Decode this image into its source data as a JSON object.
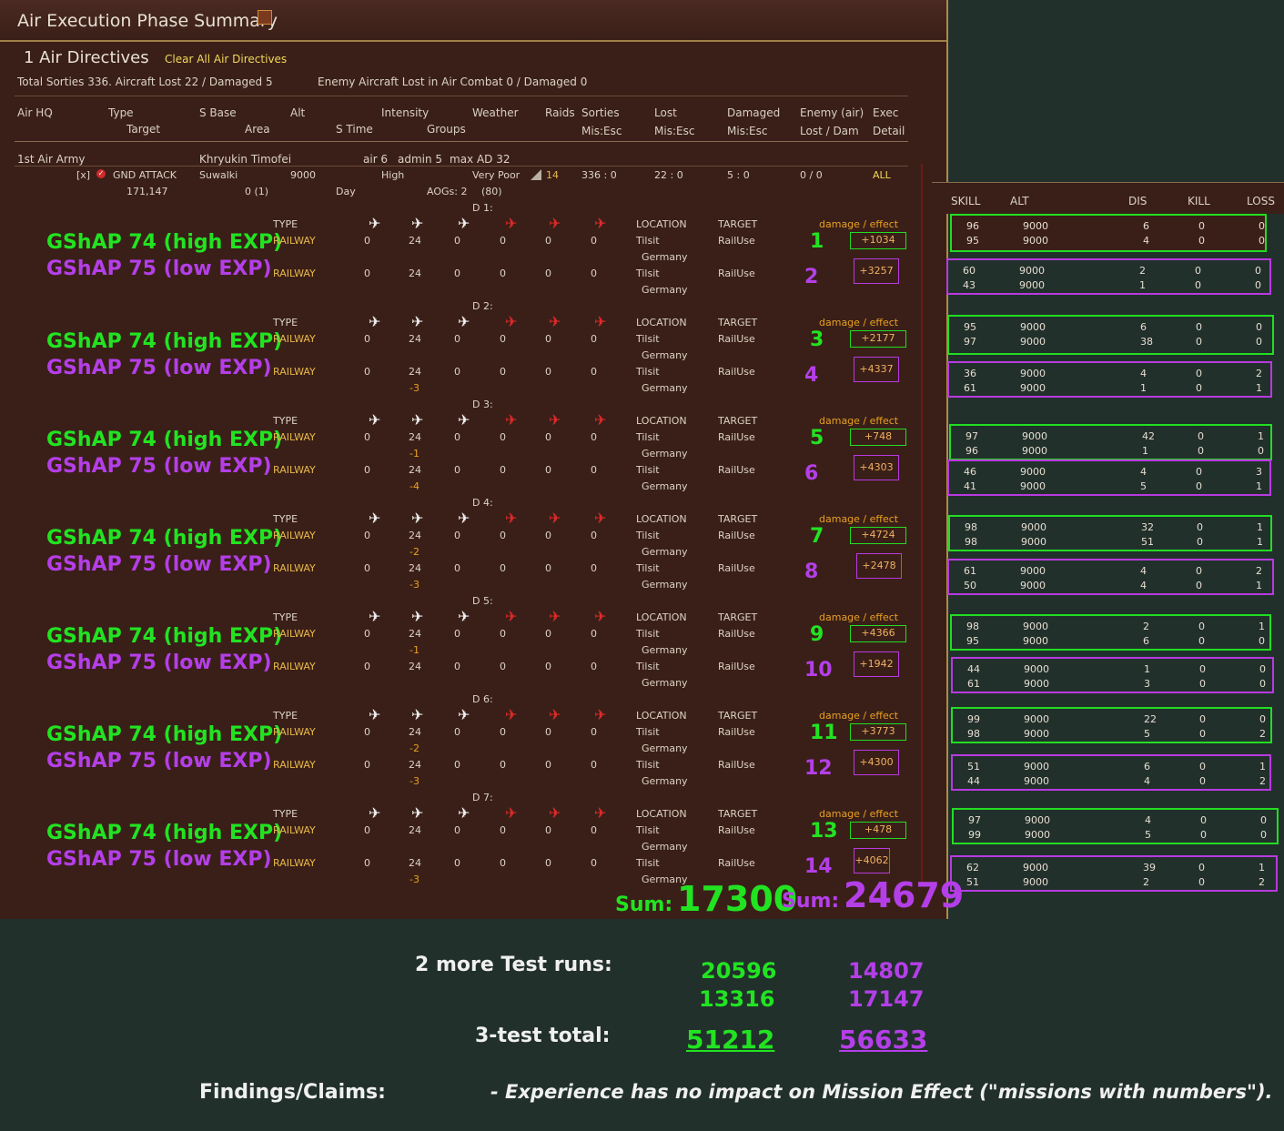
{
  "window": {
    "title": "Air Execution Phase Summary",
    "icon": "notes-icon"
  },
  "directives": {
    "title": "1 Air Directives",
    "clear_link": "Clear All Air Directives"
  },
  "summary": {
    "sorties": "Total Sorties 336. Aircraft Lost 22 / Damaged 5",
    "enemy": "Enemy Aircraft Lost in Air Combat 0 / Damaged 0"
  },
  "columns": {
    "air_hq": "Air HQ",
    "type": "Type",
    "target": "Target",
    "s_base": "S Base",
    "area": "Area",
    "alt": "Alt",
    "s_time": "S Time",
    "intensity": "Intensity",
    "groups": "Groups",
    "weather": "Weather",
    "raids": "Raids",
    "sorties": "Sorties",
    "mis_esc1": "Mis:Esc",
    "lost": "Lost",
    "mis_esc2": "Mis:Esc",
    "damaged": "Damaged",
    "mis_esc3": "Mis:Esc",
    "enemy_air": "Enemy (air)",
    "lost_dam": "Lost / Dam",
    "exec": "Exec",
    "detail": "Detail"
  },
  "hq": {
    "name": "1st Air Army",
    "commander": "Khryukin Timofei",
    "air": "air 6",
    "admin": "admin 5",
    "max_ad": "max AD 32"
  },
  "mission": {
    "checkbox": "[x]",
    "type": "GND ATTACK",
    "target": "Suwalki",
    "alt": "9000",
    "intensity": "High",
    "weather": "Very Poor",
    "raids": "14",
    "sorties": "336 : 0",
    "lost": "22 : 0",
    "damaged": "5 : 0",
    "enemy": "0 / 0",
    "exec": "ALL",
    "coords": "171,147",
    "area": "0 (1)",
    "s_time": "Day",
    "groups": "AOGs: 2",
    "groups_n": "(80)"
  },
  "labels": {
    "type": "TYPE",
    "location": "LOCATION",
    "target": "TARGET",
    "damage_effect": "damage / effect",
    "country": "Germany",
    "sum": "Sum:"
  },
  "days": [
    {
      "label": "D 1:",
      "a": {
        "name": "GShAP 74 (high EXP)",
        "type": "RAILWAY",
        "v1": "0",
        "v2": "24",
        "v3": "0",
        "v4": "0",
        "v5": "0",
        "v6": "0",
        "loss": "",
        "loc": "Tilsit",
        "target": "RailUse",
        "num": "1",
        "eff": "+1034"
      },
      "b": {
        "name": "GShAP 75 (low EXP)",
        "type": "RAILWAY",
        "v1": "0",
        "v2": "24",
        "v3": "0",
        "v4": "0",
        "v5": "0",
        "v6": "0",
        "loss": "",
        "loc": "Tilsit",
        "target": "RailUse",
        "num": "2",
        "eff": "+3257"
      }
    },
    {
      "label": "D 2:",
      "a": {
        "name": "GShAP 74 (high EXP)",
        "type": "RAILWAY",
        "v1": "0",
        "v2": "24",
        "v3": "0",
        "v4": "0",
        "v5": "0",
        "v6": "0",
        "loss": "",
        "loc": "Tilsit",
        "target": "RailUse",
        "num": "3",
        "eff": "+2177"
      },
      "b": {
        "name": "GShAP 75 (low EXP)",
        "type": "RAILWAY",
        "v1": "0",
        "v2": "24",
        "v3": "0",
        "v4": "0",
        "v5": "0",
        "v6": "0",
        "loss": "-3",
        "loc": "Tilsit",
        "target": "RailUse",
        "num": "4",
        "eff": "+4337"
      }
    },
    {
      "label": "D 3:",
      "a": {
        "name": "GShAP 74 (high EXP)",
        "type": "RAILWAY",
        "v1": "0",
        "v2": "24",
        "v3": "0",
        "v4": "0",
        "v5": "0",
        "v6": "0",
        "loss": "-1",
        "loc": "Tilsit",
        "target": "RailUse",
        "num": "5",
        "eff": "+748"
      },
      "b": {
        "name": "GShAP 75 (low EXP)",
        "type": "RAILWAY",
        "v1": "0",
        "v2": "24",
        "v3": "0",
        "v4": "0",
        "v5": "0",
        "v6": "0",
        "loss": "-4",
        "loc": "Tilsit",
        "target": "RailUse",
        "num": "6",
        "eff": "+4303"
      }
    },
    {
      "label": "D 4:",
      "a": {
        "name": "GShAP 74 (high EXP)",
        "type": "RAILWAY",
        "v1": "0",
        "v2": "24",
        "v3": "0",
        "v4": "0",
        "v5": "0",
        "v6": "0",
        "loss": "-2",
        "loc": "Tilsit",
        "target": "RailUse",
        "num": "7",
        "eff": "+4724"
      },
      "b": {
        "name": "GShAP 75 (low EXP)",
        "type": "RAILWAY",
        "v1": "0",
        "v2": "24",
        "v3": "0",
        "v4": "0",
        "v5": "0",
        "v6": "0",
        "loss": "-3",
        "loc": "Tilsit",
        "target": "RailUse",
        "num": "8",
        "eff": "+2478"
      }
    },
    {
      "label": "D 5:",
      "a": {
        "name": "GShAP 74 (high EXP)",
        "type": "RAILWAY",
        "v1": "0",
        "v2": "24",
        "v3": "0",
        "v4": "0",
        "v5": "0",
        "v6": "0",
        "loss": "-1",
        "loc": "Tilsit",
        "target": "RailUse",
        "num": "9",
        "eff": "+4366"
      },
      "b": {
        "name": "GShAP 75 (low EXP)",
        "type": "RAILWAY",
        "v1": "0",
        "v2": "24",
        "v3": "0",
        "v4": "0",
        "v5": "0",
        "v6": "0",
        "loss": "",
        "loc": "Tilsit",
        "target": "RailUse",
        "num": "10",
        "eff": "+1942"
      }
    },
    {
      "label": "D 6:",
      "a": {
        "name": "GShAP 74 (high EXP)",
        "type": "RAILWAY",
        "v1": "0",
        "v2": "24",
        "v3": "0",
        "v4": "0",
        "v5": "0",
        "v6": "0",
        "loss": "-2",
        "loc": "Tilsit",
        "target": "RailUse",
        "num": "11",
        "eff": "+3773"
      },
      "b": {
        "name": "GShAP 75 (low EXP)",
        "type": "RAILWAY",
        "v1": "0",
        "v2": "24",
        "v3": "0",
        "v4": "0",
        "v5": "0",
        "v6": "0",
        "loss": "-3",
        "loc": "Tilsit",
        "target": "RailUse",
        "num": "12",
        "eff": "+4300"
      }
    },
    {
      "label": "D 7:",
      "a": {
        "name": "GShAP 74 (high EXP)",
        "type": "RAILWAY",
        "v1": "0",
        "v2": "24",
        "v3": "0",
        "v4": "0",
        "v5": "0",
        "v6": "0",
        "loss": "",
        "loc": "Tilsit",
        "target": "RailUse",
        "num": "13",
        "eff": "+478"
      },
      "b": {
        "name": "GShAP 75 (low EXP)",
        "type": "RAILWAY",
        "v1": "0",
        "v2": "24",
        "v3": "0",
        "v4": "0",
        "v5": "0",
        "v6": "0",
        "loss": "-3",
        "loc": "Tilsit",
        "target": "RailUse",
        "num": "14",
        "eff": "+4062"
      }
    }
  ],
  "sums": {
    "green": "17300",
    "purple": "24679"
  },
  "side_table": {
    "headers": {
      "skill": "SKILL",
      "alt": "ALT",
      "dis": "DIS",
      "kill": "KILL",
      "loss": "LOSS"
    },
    "boxes": [
      {
        "rows": [
          [
            "96",
            "9000",
            "6",
            "0",
            "0"
          ],
          [
            "95",
            "9000",
            "4",
            "0",
            "0"
          ]
        ]
      },
      {
        "rows": [
          [
            "60",
            "9000",
            "2",
            "0",
            "0"
          ],
          [
            "43",
            "9000",
            "1",
            "0",
            "0"
          ]
        ]
      },
      {
        "rows": [
          [
            "95",
            "9000",
            "6",
            "0",
            "0"
          ],
          [
            "97",
            "9000",
            "38",
            "0",
            "0"
          ]
        ]
      },
      {
        "rows": [
          [
            "36",
            "9000",
            "4",
            "0",
            "2"
          ],
          [
            "61",
            "9000",
            "1",
            "0",
            "1"
          ]
        ]
      },
      {
        "rows": [
          [
            "97",
            "9000",
            "42",
            "0",
            "1"
          ],
          [
            "96",
            "9000",
            "1",
            "0",
            "0"
          ]
        ]
      },
      {
        "rows": [
          [
            "46",
            "9000",
            "4",
            "0",
            "3"
          ],
          [
            "41",
            "9000",
            "5",
            "0",
            "1"
          ]
        ]
      },
      {
        "rows": [
          [
            "98",
            "9000",
            "32",
            "0",
            "1"
          ],
          [
            "98",
            "9000",
            "51",
            "0",
            "1"
          ]
        ]
      },
      {
        "rows": [
          [
            "61",
            "9000",
            "4",
            "0",
            "2"
          ],
          [
            "50",
            "9000",
            "4",
            "0",
            "1"
          ]
        ]
      },
      {
        "rows": [
          [
            "98",
            "9000",
            "2",
            "0",
            "1"
          ],
          [
            "95",
            "9000",
            "6",
            "0",
            "0"
          ]
        ]
      },
      {
        "rows": [
          [
            "44",
            "9000",
            "1",
            "0",
            "0"
          ],
          [
            "61",
            "9000",
            "3",
            "0",
            "0"
          ]
        ]
      },
      {
        "rows": [
          [
            "99",
            "9000",
            "22",
            "0",
            "0"
          ],
          [
            "98",
            "9000",
            "5",
            "0",
            "2"
          ]
        ]
      },
      {
        "rows": [
          [
            "51",
            "9000",
            "6",
            "0",
            "1"
          ],
          [
            "44",
            "9000",
            "4",
            "0",
            "2"
          ]
        ]
      },
      {
        "rows": [
          [
            "97",
            "9000",
            "4",
            "0",
            "0"
          ],
          [
            "99",
            "9000",
            "5",
            "0",
            "0"
          ]
        ]
      },
      {
        "rows": [
          [
            "62",
            "9000",
            "39",
            "0",
            "1"
          ],
          [
            "51",
            "9000",
            "2",
            "0",
            "2"
          ]
        ]
      }
    ]
  },
  "footer": {
    "more_runs_label": "2 more Test runs:",
    "run2_green": "20596",
    "run2_purple": "14807",
    "run3_green": "13316",
    "run3_purple": "17147",
    "total_label": "3-test total:",
    "total_green": "51212",
    "total_purple": "56633",
    "findings_label": "Findings/Claims:",
    "claim": "- Experience has no impact on Mission Effect (\"missions with numbers\")."
  },
  "colors": {
    "green": "#22e322",
    "purple": "#b43fe8",
    "panel": "#3a1f18",
    "background": "#22302c"
  }
}
